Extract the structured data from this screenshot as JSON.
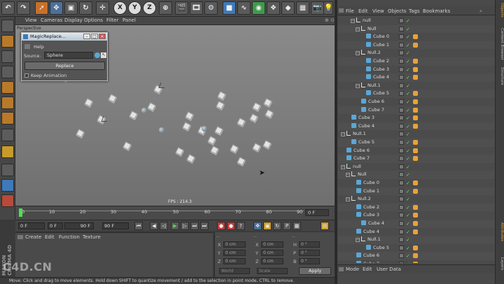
{
  "viewport_menu": [
    "View",
    "Cameras",
    "Display",
    "Options",
    "Filter",
    "Panel"
  ],
  "viewport_label": "Perspective",
  "fps_text": "FPS : 214.3",
  "dialog": {
    "title": "MagicReplace...",
    "help": "Help",
    "source_label": "Source",
    "source_value": "Sphere",
    "replace_label": "Replace",
    "keep_animation_label": "Keep Animation"
  },
  "toolbar": {
    "axis_x": "X",
    "axis_y": "Y",
    "axis_z": "Z"
  },
  "timeline": {
    "ticks": [
      "0",
      "10",
      "20",
      "30",
      "40",
      "50",
      "60",
      "70",
      "80",
      "90"
    ],
    "current_frame": "0 F"
  },
  "transport": {
    "start": "0 F",
    "min": "0 F",
    "max": "90 F",
    "end": "90 F"
  },
  "material_menu": [
    "Create",
    "Edit",
    "Function",
    "Texture"
  ],
  "coord": {
    "labels_pos": [
      "X",
      "Y",
      "Z"
    ],
    "labels_size": [
      "X",
      "Y",
      "Z"
    ],
    "labels_rot": [
      "H",
      "P",
      "B"
    ],
    "value_pos": "0 cm",
    "value_rot": "0 °",
    "mode_world": "World",
    "mode_scale": "Scale",
    "apply_label": "Apply"
  },
  "status_text": "Move: Click and drag to move elements. Hold down SHIFT to quantize movement / add to the selection in point mode, CTRL to remove.",
  "watermark": "C4D.CN",
  "maxon_text": "MAXON CINEMA 4D",
  "object_manager": {
    "menu": [
      "File",
      "Edit",
      "View",
      "Objects",
      "Tags",
      "Bookmarks"
    ],
    "bottom_menu": [
      "Mode",
      "Edit",
      "User Data"
    ],
    "rows": [
      {
        "name": "null",
        "type": "null",
        "indent": 3
      },
      {
        "name": "Null",
        "type": "null",
        "indent": 4
      },
      {
        "name": "Cube 0",
        "type": "cube",
        "indent": 5
      },
      {
        "name": "Cube 1",
        "type": "cube",
        "indent": 5
      },
      {
        "name": "Null.2",
        "type": "null",
        "indent": 4
      },
      {
        "name": "Cube 2",
        "type": "cube",
        "indent": 5
      },
      {
        "name": "Cube 3",
        "type": "cube",
        "indent": 5
      },
      {
        "name": "Cube 4",
        "type": "cube",
        "indent": 5
      },
      {
        "name": "Null.1",
        "type": "null",
        "indent": 4
      },
      {
        "name": "Cube 5",
        "type": "cube",
        "indent": 5
      },
      {
        "name": "Cube 6",
        "type": "cube",
        "indent": 4
      },
      {
        "name": "Cube 7",
        "type": "cube",
        "indent": 4
      },
      {
        "name": "Cube 3",
        "type": "cube",
        "indent": 2
      },
      {
        "name": "Cube 4",
        "type": "cube",
        "indent": 2
      },
      {
        "name": "Null.1",
        "type": "null",
        "indent": 1
      },
      {
        "name": "Cube 5",
        "type": "cube",
        "indent": 2
      },
      {
        "name": "Cube 6",
        "type": "cube",
        "indent": 1
      },
      {
        "name": "Cube 7",
        "type": "cube",
        "indent": 1
      },
      {
        "name": "null",
        "type": "null",
        "indent": 1
      },
      {
        "name": "Null",
        "type": "null",
        "indent": 2
      },
      {
        "name": "Cube 0",
        "type": "cube",
        "indent": 3
      },
      {
        "name": "Cube 1",
        "type": "cube",
        "indent": 3
      },
      {
        "name": "Null.2",
        "type": "null",
        "indent": 2
      },
      {
        "name": "Cube 2",
        "type": "cube",
        "indent": 3
      },
      {
        "name": "Cube 3",
        "type": "cube",
        "indent": 3
      },
      {
        "name": "Cube 4",
        "type": "cube",
        "indent": 4
      },
      {
        "name": "Cube 4",
        "type": "cube",
        "indent": 3
      },
      {
        "name": "Null.1",
        "type": "null",
        "indent": 4
      },
      {
        "name": "Cube 5",
        "type": "cube",
        "indent": 5
      },
      {
        "name": "Cube 6",
        "type": "cube",
        "indent": 3
      },
      {
        "name": "Cube 7",
        "type": "cube",
        "indent": 3
      }
    ]
  },
  "right_tabs": [
    "Objects",
    "Content Browser",
    "Structure",
    "Attributes",
    "Layers"
  ]
}
